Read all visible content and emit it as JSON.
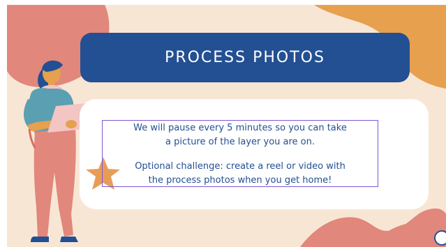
{
  "slide": {
    "title": "PROCESS PHOTOS",
    "body_line_1": "We will pause every 5 minutes so you can take",
    "body_line_2": "a picture of the layer you are on.",
    "body_line_3": "Optional challenge: create a reel or video with",
    "body_line_4": "the process photos when you get home!"
  },
  "colors": {
    "background": "#f8e6d5",
    "title_bar": "#234f93",
    "text": "#234f93",
    "text_box_border": "#7e57d6",
    "blob_pink": "#e2877b",
    "blob_orange": "#e6a04e",
    "heart": "#5b9fb2",
    "star": "#e79d58"
  },
  "icons": [
    "heart-icon",
    "star-icon",
    "person-with-laptop-illustration"
  ]
}
